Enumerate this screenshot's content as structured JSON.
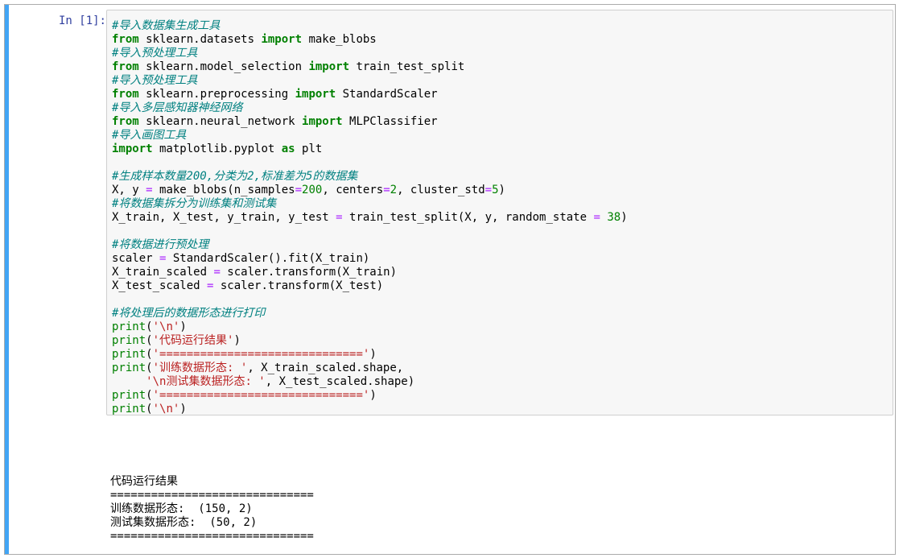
{
  "cell": {
    "prompt": "In [1]:",
    "accent_color": "#42a5f5"
  },
  "code": {
    "l1": "#导入数据集生成工具",
    "l2_kw1": "from",
    "l2_mod": " sklearn.datasets ",
    "l2_kw2": "import",
    "l2_name": " make_blobs",
    "l3": "#导入预处理工具",
    "l4_kw1": "from",
    "l4_mod": " sklearn.model_selection ",
    "l4_kw2": "import",
    "l4_name": " train_test_split",
    "l5": "#导入预处理工具",
    "l6_kw1": "from",
    "l6_mod": " sklearn.preprocessing ",
    "l6_kw2": "import",
    "l6_name": " StandardScaler",
    "l7": "#导入多层感知器神经网络",
    "l8_kw1": "from",
    "l8_mod": " sklearn.neural_network ",
    "l8_kw2": "import",
    "l8_name": " MLPClassifier",
    "l9": "#导入画图工具",
    "l10_kw1": "import",
    "l10_mod": " matplotlib.pyplot ",
    "l10_kw2": "as",
    "l10_name": " plt",
    "l12": "#生成样本数量200,分类为2,标准差为5的数据集",
    "l13_a": "X, y ",
    "l13_eq": "=",
    "l13_b": " make_blobs(n_samples",
    "l13_eq2": "=",
    "l13_n1": "200",
    "l13_c": ", centers",
    "l13_eq3": "=",
    "l13_n2": "2",
    "l13_d": ", cluster_std",
    "l13_eq4": "=",
    "l13_n3": "5",
    "l13_e": ")",
    "l14": "#将数据集拆分为训练集和测试集",
    "l15_a": "X_train, X_test, y_train, y_test ",
    "l15_eq": "=",
    "l15_b": " train_test_split(X, y, random_state ",
    "l15_eq2": "=",
    "l15_sp": " ",
    "l15_n": "38",
    "l15_c": ")",
    "l17": "#将数据进行预处理",
    "l18_a": "scaler ",
    "l18_eq": "=",
    "l18_b": " StandardScaler().fit(X_train)",
    "l19_a": "X_train_scaled ",
    "l19_eq": "=",
    "l19_b": " scaler.transform(X_train)",
    "l20_a": "X_test_scaled ",
    "l20_eq": "=",
    "l20_b": " scaler.transform(X_test)",
    "l22": "#将处理后的数据形态进行打印",
    "p_fn": "print",
    "l23_s": "'\\n'",
    "l24_s": "'代码运行结果'",
    "l25_s": "'=============================='",
    "l26_s": "'训练数据形态: '",
    "l26_b": ", X_train_scaled.shape,",
    "l27_indent": "     ",
    "l27_s": "'\\n测试集数据形态: '",
    "l27_b": ", X_test_scaled.shape)",
    "l28_s": "'=============================='",
    "l29_s": "'\\n'"
  },
  "output": {
    "lines": [
      "",
      "",
      "代码运行结果",
      "==============================",
      "训练数据形态:  (150, 2)",
      "测试集数据形态:  (50, 2)",
      "=============================="
    ]
  }
}
